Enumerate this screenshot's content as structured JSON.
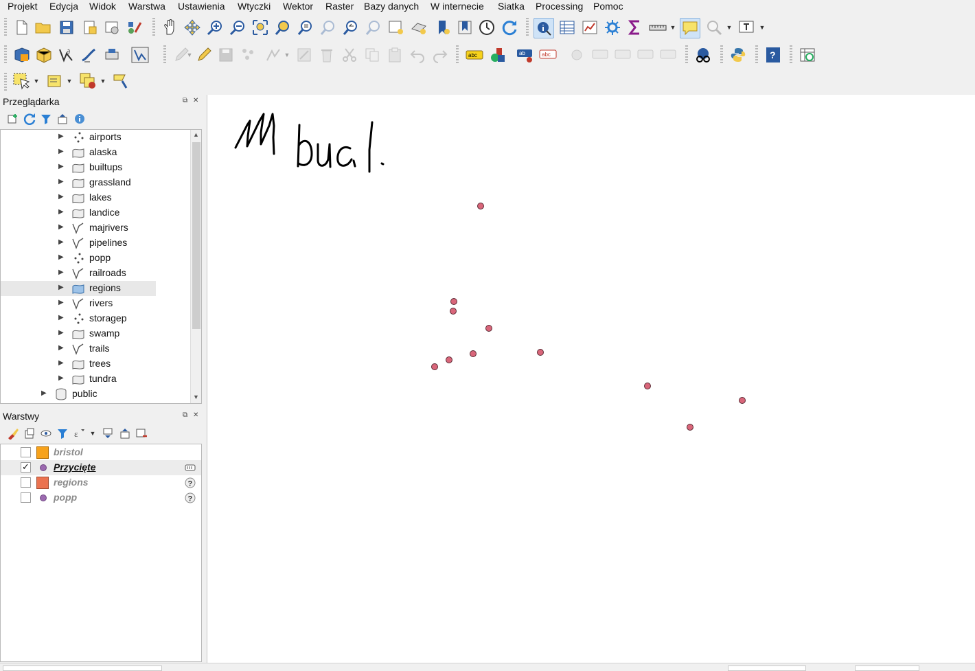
{
  "menu": {
    "items": [
      {
        "name": "menu-projekt",
        "label": "Projekt"
      },
      {
        "name": "menu-edycja",
        "label": "Edycja"
      },
      {
        "name": "menu-widok",
        "label": "Widok"
      },
      {
        "name": "menu-warstwa",
        "label": "Warstwa"
      },
      {
        "name": "menu-ustawienia",
        "label": "Ustawienia"
      },
      {
        "name": "menu-wtyczki",
        "label": "Wtyczki"
      },
      {
        "name": "menu-wektor",
        "label": "Wektor"
      },
      {
        "name": "menu-raster",
        "label": "Raster"
      },
      {
        "name": "menu-bazy-danych",
        "label": "Bazy danych"
      },
      {
        "name": "menu-w-internecie",
        "label": "W internecie"
      },
      {
        "name": "menu-siatka",
        "label": "Siatka"
      },
      {
        "name": "menu-processing",
        "label": "Processing"
      },
      {
        "name": "menu-pomoc",
        "label": "Pomoc"
      }
    ]
  },
  "browser": {
    "title": "Przeglądarka",
    "items": [
      {
        "label": "airports",
        "kind": "point"
      },
      {
        "label": "alaska",
        "kind": "polygon"
      },
      {
        "label": "builtups",
        "kind": "polygon"
      },
      {
        "label": "grassland",
        "kind": "polygon"
      },
      {
        "label": "lakes",
        "kind": "polygon"
      },
      {
        "label": "landice",
        "kind": "polygon"
      },
      {
        "label": "majrivers",
        "kind": "line"
      },
      {
        "label": "pipelines",
        "kind": "line"
      },
      {
        "label": "popp",
        "kind": "point"
      },
      {
        "label": "railroads",
        "kind": "line"
      },
      {
        "label": "regions",
        "kind": "polygon",
        "selected": true
      },
      {
        "label": "rivers",
        "kind": "line"
      },
      {
        "label": "storagep",
        "kind": "point"
      },
      {
        "label": "swamp",
        "kind": "polygon"
      },
      {
        "label": "trails",
        "kind": "line"
      },
      {
        "label": "trees",
        "kind": "polygon"
      },
      {
        "label": "tundra",
        "kind": "polygon"
      },
      {
        "label": "public",
        "kind": "schema"
      }
    ]
  },
  "layers": {
    "title": "Warstwy",
    "items": [
      {
        "label": "bristol",
        "visible": false,
        "symbol": "square",
        "color": "#f7a21b",
        "indicator": ""
      },
      {
        "label": "Przycięte",
        "visible": true,
        "symbol": "dot",
        "color": "#9c6ab0",
        "indicator": "memory-layer-icon"
      },
      {
        "label": "regions",
        "visible": false,
        "symbol": "square",
        "color": "#eb7350",
        "indicator": "question-icon"
      },
      {
        "label": "popp",
        "visible": false,
        "symbol": "dot",
        "color": "#9c6ab0",
        "indicator": "question-icon"
      }
    ]
  },
  "map": {
    "annotation": "11 bud.",
    "point_color": "#d9667a",
    "point_count": 11
  }
}
